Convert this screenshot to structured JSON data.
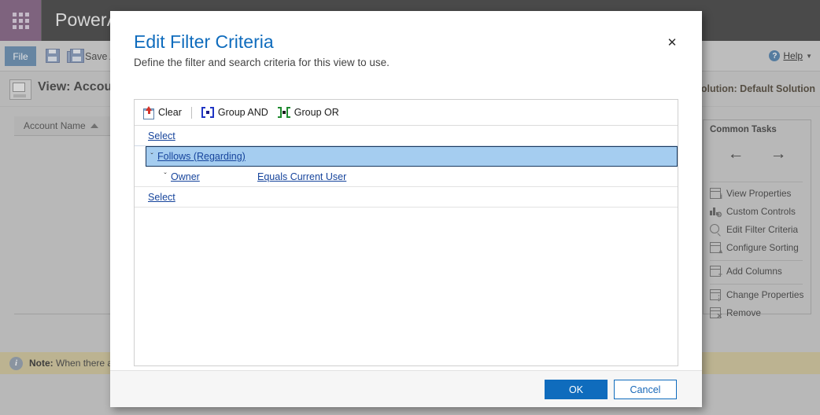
{
  "app": {
    "brand": "PowerApps",
    "waffle_icon": "app-launcher-grid-icon",
    "ribbon": {
      "file_tab": "File",
      "save_icon": "save-floppy-icon",
      "save_as_icon": "save-as-floppy-icon",
      "save_as_label": "Save A",
      "help_icon": "help-circle-icon",
      "help_label": "Help",
      "help_caret": "▼"
    },
    "view": {
      "icon": "view-window-icon",
      "title": "View: Accou",
      "solution_text": "n solution: Default Solution"
    },
    "grid": {
      "columns": [
        "Account Name"
      ],
      "sort_indicator": "sort-ascending-caret"
    },
    "note": {
      "icon": "info-circle-icon",
      "label": "Note:",
      "text": "When there are"
    },
    "common_tasks": {
      "title": "Common Tasks",
      "back_arrow": "←",
      "forward_arrow": "→",
      "items": [
        {
          "label": "View Properties",
          "icon": "view-properties-icon"
        },
        {
          "label": "Custom Controls",
          "icon": "custom-controls-icon"
        },
        {
          "label": "Edit Filter Criteria",
          "icon": "magnifier-icon"
        },
        {
          "label": "Configure Sorting",
          "icon": "configure-sorting-icon"
        },
        {
          "label": "Add Columns",
          "icon": "add-columns-icon"
        },
        {
          "label": "Change Properties",
          "icon": "change-properties-icon"
        },
        {
          "label": "Remove",
          "icon": "remove-icon"
        }
      ]
    }
  },
  "dialog": {
    "title": "Edit Filter Criteria",
    "subtitle": "Define the filter and search criteria for this view to use.",
    "close_icon": "close-x-icon",
    "toolbar": {
      "clear_label": "Clear",
      "clear_icon": "clear-page-icon",
      "group_and_label": "Group AND",
      "group_and_icon": "group-and-brackets-icon",
      "group_or_label": "Group OR",
      "group_or_icon": "group-or-brackets-icon"
    },
    "rows": [
      {
        "id": "select-top",
        "type": "select",
        "label": "Select",
        "indent": 1,
        "selected": false,
        "caret": ""
      },
      {
        "id": "follows-regarding",
        "type": "entity",
        "label": "Follows (Regarding)",
        "indent": 1,
        "selected": true,
        "caret": "ˇ"
      },
      {
        "id": "owner-condition",
        "type": "condition",
        "label": "Owner",
        "operator": "Equals Current User",
        "indent": 2,
        "selected": false,
        "caret": "ˇ"
      },
      {
        "id": "select-bottom",
        "type": "select",
        "label": "Select",
        "indent": 1,
        "selected": false,
        "caret": ""
      }
    ],
    "footer": {
      "ok_label": "OK",
      "cancel_label": "Cancel"
    }
  },
  "colors": {
    "accent_blue": "#0f6cbd",
    "title_blue": "#0f6cbd",
    "link_blue": "#16449c",
    "selected_row_bg": "#a5cdf0",
    "selected_row_border": "#17375e",
    "brand_purple": "#7e5c7e",
    "topbar_dark": "#3b3b3b",
    "note_bar": "#cdc297",
    "group_and_icon": "#1f35c4",
    "group_or_icon": "#1f8a2f",
    "clear_icon_red": "#d4352a"
  }
}
